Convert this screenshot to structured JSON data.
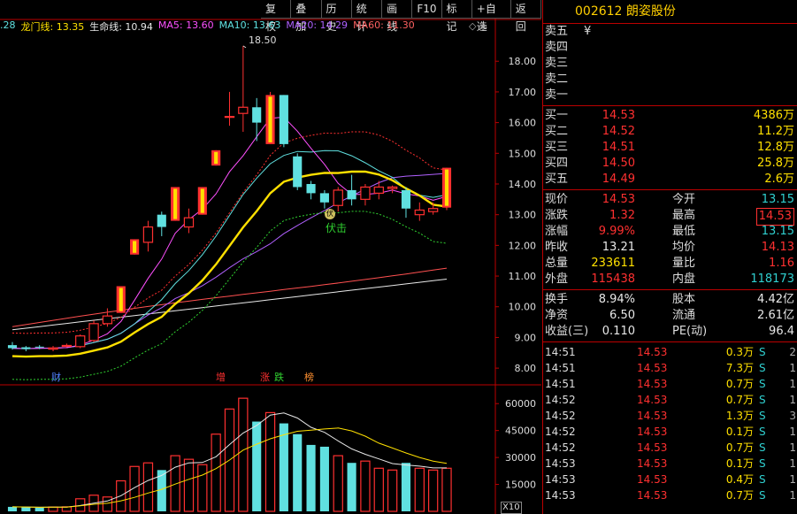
{
  "toolbar": [
    "复权",
    "叠加",
    "历史",
    "统计",
    "画线",
    "F10",
    "标记",
    "+自选",
    "返回"
  ],
  "legend": {
    "prefix": ".28",
    "items": [
      {
        "label": "龙门线: 13.35",
        "color": "#ffe000"
      },
      {
        "label": "生命线: 10.94",
        "color": "#e8e8e8"
      },
      {
        "label": "MA5: 13.60",
        "color": "#ff50ff"
      },
      {
        "label": "MA10: 13.63",
        "color": "#60e0e0"
      },
      {
        "label": "MA20: 14.29",
        "color": "#b060ff"
      },
      {
        "label": "MA60: 11.30",
        "color": "#ff6060"
      }
    ],
    "icons": "◇ ◈"
  },
  "annotations": {
    "high": "18.50",
    "signal": "伏击",
    "signal_badge": "伏",
    "events": [
      {
        "text": "财",
        "color": "#5080ff"
      },
      {
        "text": "增",
        "color": "#ff3030"
      },
      {
        "text": "涨",
        "color": "#ff3030"
      },
      {
        "text": "跌",
        "color": "#30d030"
      },
      {
        "text": "榜",
        "color": "#ff9030"
      }
    ],
    "x10": "X10"
  },
  "price_axis": [
    "18.00",
    "17.00",
    "16.00",
    "15.00",
    "14.00",
    "13.00",
    "12.00",
    "11.00",
    "10.00",
    "9.00",
    "8.00"
  ],
  "volume_axis": [
    "60000",
    "45000",
    "30000",
    "15000"
  ],
  "chart_data": {
    "type": "candlestick",
    "ylim": [
      7.6,
      18.9
    ],
    "candles": [
      {
        "o": 8.75,
        "c": 8.65,
        "h": 8.85,
        "l": 8.6
      },
      {
        "o": 8.68,
        "c": 8.62,
        "h": 8.72,
        "l": 8.55
      },
      {
        "o": 8.7,
        "c": 8.68,
        "h": 8.75,
        "l": 8.62
      },
      {
        "o": 8.62,
        "c": 8.66,
        "h": 8.72,
        "l": 8.55
      },
      {
        "o": 8.72,
        "c": 8.74,
        "h": 8.8,
        "l": 8.68
      },
      {
        "o": 8.7,
        "c": 9.05,
        "h": 9.1,
        "l": 8.65
      },
      {
        "o": 8.9,
        "c": 9.45,
        "h": 9.55,
        "l": 8.85
      },
      {
        "o": 9.45,
        "c": 9.7,
        "h": 9.95,
        "l": 9.35
      },
      {
        "o": 9.8,
        "c": 10.67,
        "h": 10.67,
        "l": 9.8
      },
      {
        "o": 11.7,
        "c": 12.2,
        "h": 12.2,
        "l": 11.7
      },
      {
        "o": 12.1,
        "c": 12.6,
        "h": 12.8,
        "l": 11.8
      },
      {
        "o": 13.0,
        "c": 12.6,
        "h": 13.1,
        "l": 12.3
      },
      {
        "o": 12.8,
        "c": 13.9,
        "h": 13.9,
        "l": 12.8
      },
      {
        "o": 12.6,
        "c": 12.9,
        "h": 13.2,
        "l": 12.4
      },
      {
        "o": 13.0,
        "c": 13.9,
        "h": 13.9,
        "l": 13.0
      },
      {
        "o": 14.6,
        "c": 15.1,
        "h": 15.1,
        "l": 14.6
      },
      {
        "o": 16.2,
        "c": 16.2,
        "h": 17.0,
        "l": 15.9
      },
      {
        "o": 16.3,
        "c": 16.5,
        "h": 18.5,
        "l": 15.7
      },
      {
        "o": 16.5,
        "c": 16.0,
        "h": 16.8,
        "l": 15.4
      },
      {
        "o": 15.3,
        "c": 16.9,
        "h": 17.0,
        "l": 15.3
      },
      {
        "o": 16.9,
        "c": 15.3,
        "h": 16.9,
        "l": 15.2
      },
      {
        "o": 14.9,
        "c": 13.9,
        "h": 15.0,
        "l": 13.8
      },
      {
        "o": 14.0,
        "c": 13.7,
        "h": 14.1,
        "l": 13.5
      },
      {
        "o": 13.7,
        "c": 13.4,
        "h": 13.8,
        "l": 13.2
      },
      {
        "o": 13.3,
        "c": 13.8,
        "h": 13.9,
        "l": 13.1
      },
      {
        "o": 13.8,
        "c": 13.5,
        "h": 14.3,
        "l": 13.3
      },
      {
        "o": 13.5,
        "c": 13.9,
        "h": 14.0,
        "l": 13.3
      },
      {
        "o": 13.7,
        "c": 13.9,
        "h": 14.1,
        "l": 13.5
      },
      {
        "o": 13.85,
        "c": 13.9,
        "h": 13.95,
        "l": 13.7
      },
      {
        "o": 13.8,
        "c": 13.2,
        "h": 13.9,
        "l": 12.9
      },
      {
        "o": 13.0,
        "c": 13.15,
        "h": 13.4,
        "l": 12.8
      },
      {
        "o": 13.1,
        "c": 13.2,
        "h": 13.4,
        "l": 13.0
      },
      {
        "o": 13.23,
        "c": 14.53,
        "h": 14.53,
        "l": 13.15
      }
    ],
    "limit_up": [
      8,
      9,
      12,
      14,
      15,
      19,
      32
    ],
    "volume": [
      2500,
      2300,
      2000,
      2400,
      2500,
      7000,
      9000,
      8000,
      17000,
      25000,
      27000,
      23000,
      31000,
      29000,
      26000,
      43000,
      57000,
      63000,
      50000,
      55000,
      49000,
      43000,
      37000,
      36000,
      31000,
      27000,
      28000,
      24000,
      23000,
      27000,
      24000,
      23000,
      24000
    ]
  },
  "side": {
    "code": "002612",
    "name": "朗姿股份",
    "sell": [
      {
        "label": "卖五",
        "price": "¥",
        "vol": ""
      },
      {
        "label": "卖四",
        "price": "",
        "vol": ""
      },
      {
        "label": "卖三",
        "price": "",
        "vol": ""
      },
      {
        "label": "卖二",
        "price": "",
        "vol": ""
      },
      {
        "label": "卖一",
        "price": "",
        "vol": ""
      }
    ],
    "buy": [
      {
        "label": "买一",
        "price": "14.53",
        "vol": "4386万"
      },
      {
        "label": "买二",
        "price": "14.52",
        "vol": "11.2万"
      },
      {
        "label": "买三",
        "price": "14.51",
        "vol": "12.8万"
      },
      {
        "label": "买四",
        "price": "14.50",
        "vol": "25.8万"
      },
      {
        "label": "买五",
        "price": "14.49",
        "vol": "2.6万"
      }
    ],
    "quote": [
      {
        "l1": "现价",
        "v1": "14.53",
        "c1": "red",
        "l2": "今开",
        "v2": "13.15",
        "c2": "green"
      },
      {
        "l1": "涨跌",
        "v1": "1.32",
        "c1": "red",
        "l2": "最高",
        "v2": "14.53",
        "c2": "red boxed"
      },
      {
        "l1": "涨幅",
        "v1": "9.99%",
        "c1": "red",
        "l2": "最低",
        "v2": "13.15",
        "c2": "green"
      },
      {
        "l1": "昨收",
        "v1": "13.21",
        "c1": "white",
        "l2": "均价",
        "v2": "14.13",
        "c2": "red"
      },
      {
        "l1": "总量",
        "v1": "233611",
        "c1": "yellow",
        "l2": "量比",
        "v2": "1.16",
        "c2": "red"
      },
      {
        "l1": "外盘",
        "v1": "115438",
        "c1": "red",
        "l2": "内盘",
        "v2": "118173",
        "c2": "green"
      }
    ],
    "fund": [
      {
        "l1": "换手",
        "v1": "8.94%",
        "l2": "股本",
        "v2": "4.42亿"
      },
      {
        "l1": "净资",
        "v1": "6.50",
        "l2": "流通",
        "v2": "2.61亿"
      },
      {
        "l1": "收益(三)",
        "v1": "0.110",
        "l2": "PE(动)",
        "v2": "96.4"
      }
    ],
    "ticks": [
      {
        "t": "14:51",
        "p": "14.53",
        "v": "0.3万",
        "s": "S",
        "n": "2"
      },
      {
        "t": "14:51",
        "p": "14.53",
        "v": "7.3万",
        "s": "S",
        "n": "1"
      },
      {
        "t": "14:51",
        "p": "14.53",
        "v": "0.7万",
        "s": "S",
        "n": "1"
      },
      {
        "t": "14:52",
        "p": "14.53",
        "v": "0.7万",
        "s": "S",
        "n": "1"
      },
      {
        "t": "14:52",
        "p": "14.53",
        "v": "1.3万",
        "s": "S",
        "n": "3"
      },
      {
        "t": "14:52",
        "p": "14.53",
        "v": "0.1万",
        "s": "S",
        "n": "1"
      },
      {
        "t": "14:52",
        "p": "14.53",
        "v": "0.7万",
        "s": "S",
        "n": "1"
      },
      {
        "t": "14:53",
        "p": "14.53",
        "v": "0.1万",
        "s": "S",
        "n": "1"
      },
      {
        "t": "14:53",
        "p": "14.53",
        "v": "0.4万",
        "s": "S",
        "n": "1"
      },
      {
        "t": "14:53",
        "p": "14.53",
        "v": "0.7万",
        "s": "S",
        "n": "1"
      }
    ]
  }
}
